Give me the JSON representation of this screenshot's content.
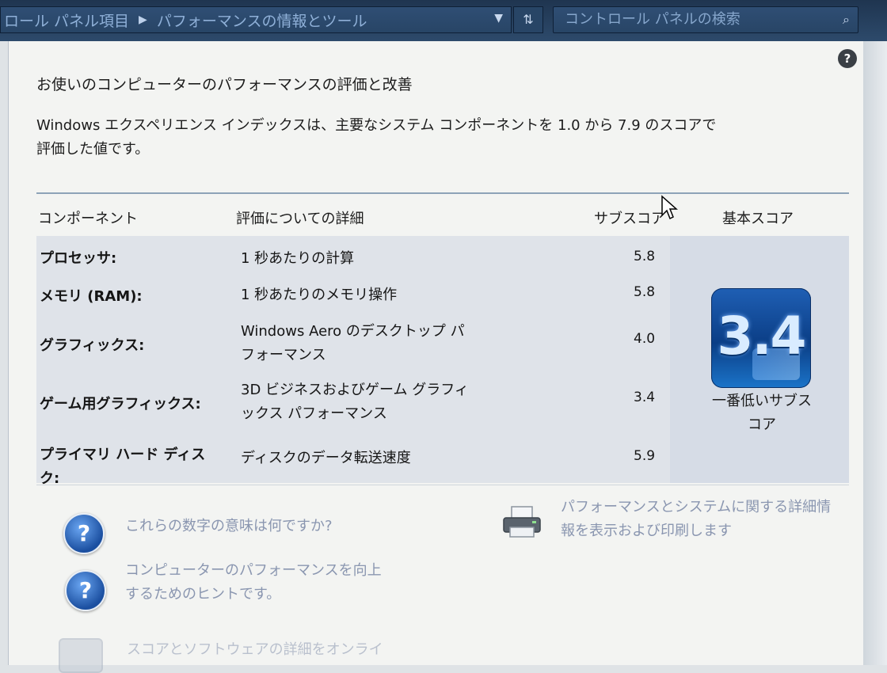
{
  "addressbar": {
    "crumb1": "ロール パネル項目",
    "crumb2": "パフォーマンスの情報とツール",
    "search_placeholder": "コントロール パネルの検索"
  },
  "page": {
    "title": "お使いのコンピューターのパフォーマンスの評価と改善",
    "desc_line1": "Windows エクスペリエンス インデックスは、主要なシステム コンポーネントを 1.0 から 7.9 のスコアで",
    "desc_line2": "評価した値です。"
  },
  "table": {
    "headers": {
      "component": "コンポーネント",
      "detail": "評価についての詳細",
      "subscore": "サブスコア",
      "basescore": "基本スコア"
    },
    "rows": [
      {
        "label": "プロセッサ:",
        "detail_l1": "1 秒あたりの計算",
        "detail_l2": "",
        "score": "5.8"
      },
      {
        "label": "メモリ (RAM):",
        "detail_l1": "1 秒あたりのメモリ操作",
        "detail_l2": "",
        "score": "5.8"
      },
      {
        "label": "グラフィックス:",
        "detail_l1": "Windows Aero のデスクトップ パ",
        "detail_l2": "フォーマンス",
        "score": "4.0"
      },
      {
        "label": "ゲーム用グラフィックス:",
        "detail_l1": "3D ビジネスおよびゲーム グラフィ",
        "detail_l2": "ックス パフォーマンス",
        "score": "3.4"
      },
      {
        "label_l1": "プライマリ ハード ディス",
        "label_l2": "ク:",
        "detail_l1": "ディスクのデータ転送速度",
        "score": "5.9"
      }
    ],
    "base_score": "3.4",
    "base_caption_l1": "一番低いサブス",
    "base_caption_l2": "コア"
  },
  "links": {
    "meaning": "これらの数字の意味は何ですか?",
    "tips_l1": "コンピューターのパフォーマンスを向上",
    "tips_l2": "するためのヒントです。",
    "details_l1": "パフォーマンスとシステムに関する詳細情",
    "details_l2": "報を表示および印刷します",
    "online": "スコアとソフトウェアの詳細をオンライ"
  },
  "colors": {
    "link": "#8a96b0",
    "tile": "#0b3e86"
  }
}
